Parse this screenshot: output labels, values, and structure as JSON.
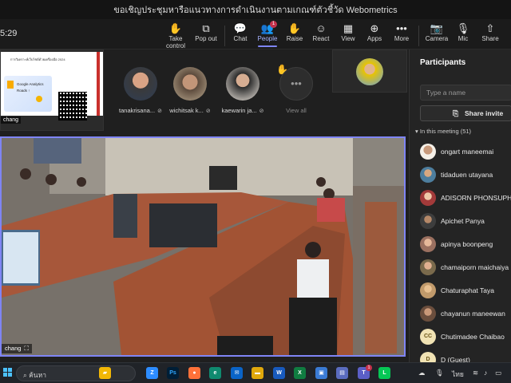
{
  "window": {
    "title": "ขอเชิญประชุมหารือแนวทางการดำเนินงานตามเกณฑ์ตัวชี้วัด Webometrics"
  },
  "toolbar": {
    "clock": "5:29",
    "items": [
      {
        "label": "Take control",
        "icon": "take-control-icon",
        "glyph": "✋"
      },
      {
        "label": "Pop out",
        "icon": "pop-out-icon",
        "glyph": "⧉"
      },
      {
        "label": "Chat",
        "icon": "chat-icon",
        "glyph": "💬"
      },
      {
        "label": "People",
        "icon": "people-icon",
        "glyph": "👥",
        "badge": "1"
      },
      {
        "label": "Raise",
        "icon": "raise-hand-icon",
        "glyph": "✋"
      },
      {
        "label": "React",
        "icon": "react-icon",
        "glyph": "☺"
      },
      {
        "label": "View",
        "icon": "view-icon",
        "glyph": "▦"
      },
      {
        "label": "Apps",
        "icon": "apps-icon",
        "glyph": "⊕"
      },
      {
        "label": "More",
        "icon": "more-icon",
        "glyph": "•••"
      },
      {
        "label": "Camera",
        "icon": "camera-off-icon",
        "glyph": "📷"
      },
      {
        "label": "Mic",
        "icon": "mic-off-icon",
        "glyph": "🎙"
      },
      {
        "label": "Share",
        "icon": "share-icon",
        "glyph": "⇧"
      }
    ]
  },
  "shared_screen": {
    "presenter": "chang",
    "slide_header": "การวิเคราะห์เว็บไซต์ด้วยเครื่องมือ 2024",
    "slide_text": "Google Analytics",
    "slide_subtext": "Roads ↑"
  },
  "gallery": {
    "participants": [
      {
        "name": "tanakrisana...",
        "avatar_color": "#c88b6a"
      },
      {
        "name": "wichitsak k...",
        "avatar_color": "#8a6a50"
      },
      {
        "name": "kaewarin ja...",
        "avatar_color": "#5a4a45"
      }
    ],
    "view_all": "View all",
    "raise_hand_glyph": "✋",
    "mic_off_glyph": "⊘"
  },
  "main_stage": {
    "presenter": "chang",
    "pin_icon_glyph": "⛶"
  },
  "participants_panel": {
    "title": "Participants",
    "search_placeholder": "Type a name",
    "share_invite": "Share invite",
    "in_meeting": "In this meeting (51)",
    "people": [
      {
        "name": "ongart maneemai",
        "avatar_color": "#7b5b44"
      },
      {
        "name": "tidaduen utayana",
        "avatar_color": "#4d7e9e"
      },
      {
        "name": "ADISORN PHONSUPHAP",
        "avatar_color": "#a33a3a"
      },
      {
        "name": "Apichet Panya",
        "avatar_color": "#3d3d3d"
      },
      {
        "name": "apinya boonpeng",
        "avatar_color": "#9b7060"
      },
      {
        "name": "chamaiporn maichaiya",
        "avatar_color": "#7a6a4c"
      },
      {
        "name": "Chaturaphat Taya",
        "avatar_color": "#c19a6b"
      },
      {
        "name": "chayanun maneewan",
        "avatar_color": "#6b4e3d"
      },
      {
        "name": "Chutimadee Chaibao",
        "initials": "CC"
      },
      {
        "name": "D (Guest)",
        "initials": "D"
      }
    ]
  },
  "taskbar": {
    "search_text": "ค้นหา",
    "language": "ไทย",
    "teams_badge": "1",
    "apps": [
      {
        "name": "file-explorer-icon",
        "color": "#f2b705",
        "glyph": "▰"
      },
      {
        "name": "zoom-icon",
        "color": "#2d8cff",
        "glyph": "Z"
      },
      {
        "name": "photoshop-icon",
        "color": "#001e36",
        "glyph": "Ps"
      },
      {
        "name": "firefox-icon",
        "color": "#ff7139",
        "glyph": "●"
      },
      {
        "name": "edge-icon",
        "color": "#0f8a6f",
        "glyph": "e"
      },
      {
        "name": "mail-icon",
        "color": "#0a64c8",
        "glyph": "✉"
      },
      {
        "name": "folder-icon",
        "color": "#e0a80c",
        "glyph": "▬"
      },
      {
        "name": "word-icon",
        "color": "#185abd",
        "glyph": "W"
      },
      {
        "name": "excel-icon",
        "color": "#107c41",
        "glyph": "X"
      },
      {
        "name": "photos-icon",
        "color": "#3a7bd5",
        "glyph": "▣"
      },
      {
        "name": "calendar-icon",
        "color": "#5a6cbf",
        "glyph": "▤"
      },
      {
        "name": "teams-icon",
        "color": "#5b5fc7",
        "glyph": "T"
      },
      {
        "name": "line-icon",
        "color": "#06c755",
        "glyph": "L"
      }
    ]
  },
  "colors": {
    "accent": "#7f85f5",
    "badge": "#c4314b"
  }
}
